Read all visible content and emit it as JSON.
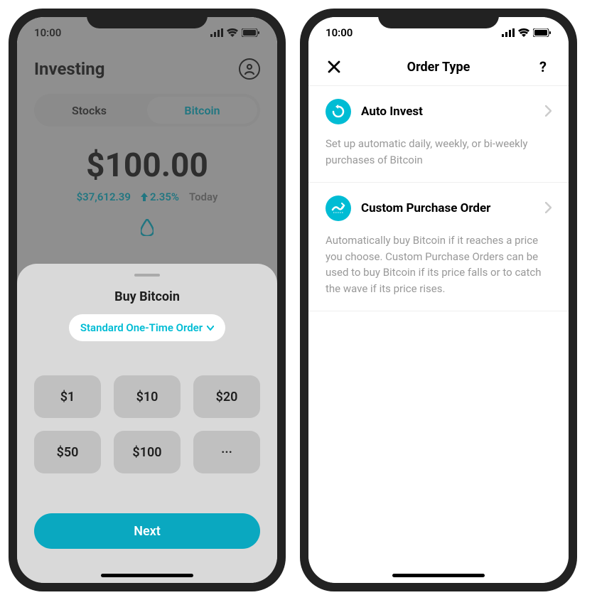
{
  "status": {
    "time": "10:00"
  },
  "phone1": {
    "header": {
      "title": "Investing"
    },
    "segments": {
      "stocks": "Stocks",
      "bitcoin": "Bitcoin"
    },
    "amount": "$100.00",
    "price": "$37,612.39",
    "pct": "2.35%",
    "today": "Today",
    "sheet": {
      "title": "Buy Bitcoin",
      "order_type": "Standard One-Time Order",
      "amounts": [
        "$1",
        "$10",
        "$20",
        "$50",
        "$100",
        "···"
      ],
      "next": "Next"
    }
  },
  "phone2": {
    "title": "Order Type",
    "help": "?",
    "options": [
      {
        "title": "Auto Invest",
        "desc": "Set up automatic daily, weekly, or bi-weekly purchases of Bitcoin"
      },
      {
        "title": "Custom Purchase Order",
        "desc": "Automatically buy Bitcoin if it reaches a price you choose. Custom Purchase Orders can be used to buy Bitcoin if its price falls or to catch the wave if its price rises."
      }
    ]
  },
  "colors": {
    "accent": "#00bcd4"
  }
}
